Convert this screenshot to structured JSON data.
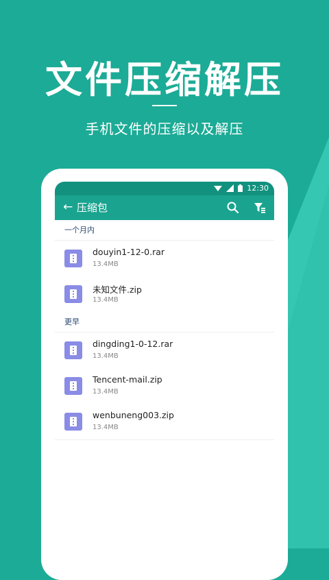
{
  "hero": {
    "title": "文件压缩解压",
    "subtitle": "手机文件的压缩以及解压"
  },
  "status_bar": {
    "time": "12:30",
    "icons": [
      "wifi-icon",
      "signal-icon",
      "battery-icon"
    ]
  },
  "app_bar": {
    "back_label": "←",
    "title": "压缩包",
    "actions": [
      "search-icon",
      "filter-icon"
    ]
  },
  "sections": [
    {
      "header": "一个月内",
      "files": [
        {
          "name": "douyin1-12-0.rar",
          "size": "13.4MB"
        },
        {
          "name": "未知文件.zip",
          "size": "13.4MB"
        }
      ]
    },
    {
      "header": "更早",
      "files": [
        {
          "name": "dingding1-0-12.rar",
          "size": "13.4MB"
        },
        {
          "name": "Tencent-mail.zip",
          "size": "13.4MB"
        },
        {
          "name": "wenbuneng003.zip",
          "size": "13.4MB"
        }
      ]
    }
  ],
  "colors": {
    "background": "#1cab96",
    "background_light": "#3fd0bb",
    "status_bar": "#12917e",
    "app_bar": "#1aa48f",
    "file_icon": "#8a8ce6",
    "section_header_text": "#2b4a73"
  }
}
